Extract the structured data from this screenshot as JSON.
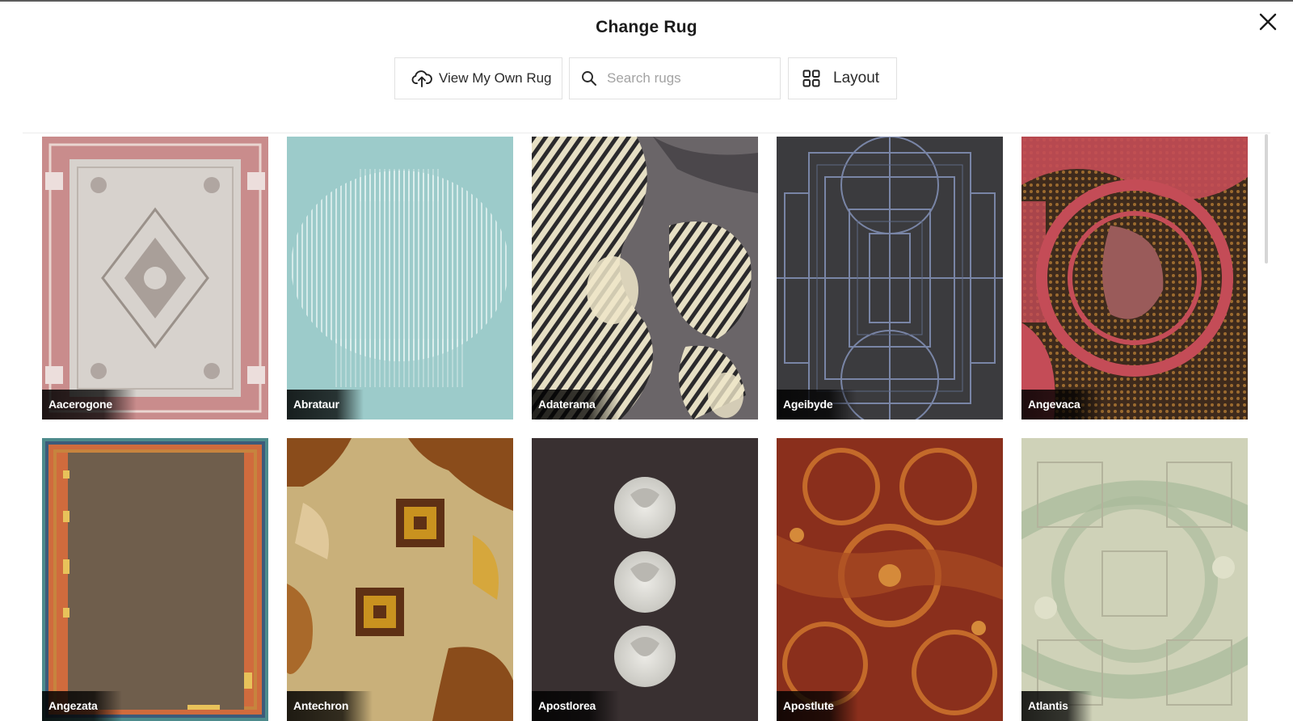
{
  "dialog": {
    "title": "Change Rug",
    "close_icon": "close-icon"
  },
  "toolbar": {
    "upload_label": "View My Own Rug",
    "upload_icon": "cloud-upload-icon",
    "search_placeholder": "Search rugs",
    "search_value": "",
    "search_icon": "search-icon",
    "layout_label": "Layout",
    "layout_icon": "grid-icon"
  },
  "rugs": [
    {
      "name": "Aacerogone",
      "colors": [
        "#d7d2cd",
        "#c98c8c"
      ]
    },
    {
      "name": "Abrataur",
      "colors": [
        "#9ccbca",
        "#e8f4f3"
      ]
    },
    {
      "name": "Adaterama",
      "colors": [
        "#6a6568",
        "#e6dfc4"
      ]
    },
    {
      "name": "Ageibyde",
      "colors": [
        "#3b3b3e",
        "#7985a6"
      ]
    },
    {
      "name": "Angevaca",
      "colors": [
        "#c44c57",
        "#3e2a1c"
      ]
    },
    {
      "name": "Angezata",
      "colors": [
        "#6f5e4c",
        "#d06b3d"
      ]
    },
    {
      "name": "Antechron",
      "colors": [
        "#c9b07a",
        "#8a4c1b"
      ]
    },
    {
      "name": "Apostlorea",
      "colors": [
        "#393031",
        "#dcdbd6"
      ]
    },
    {
      "name": "Apostlute",
      "colors": [
        "#8a2f1c",
        "#c46a2a"
      ]
    },
    {
      "name": "Atlantis",
      "colors": [
        "#cfd2b8",
        "#a7b99a"
      ]
    }
  ]
}
